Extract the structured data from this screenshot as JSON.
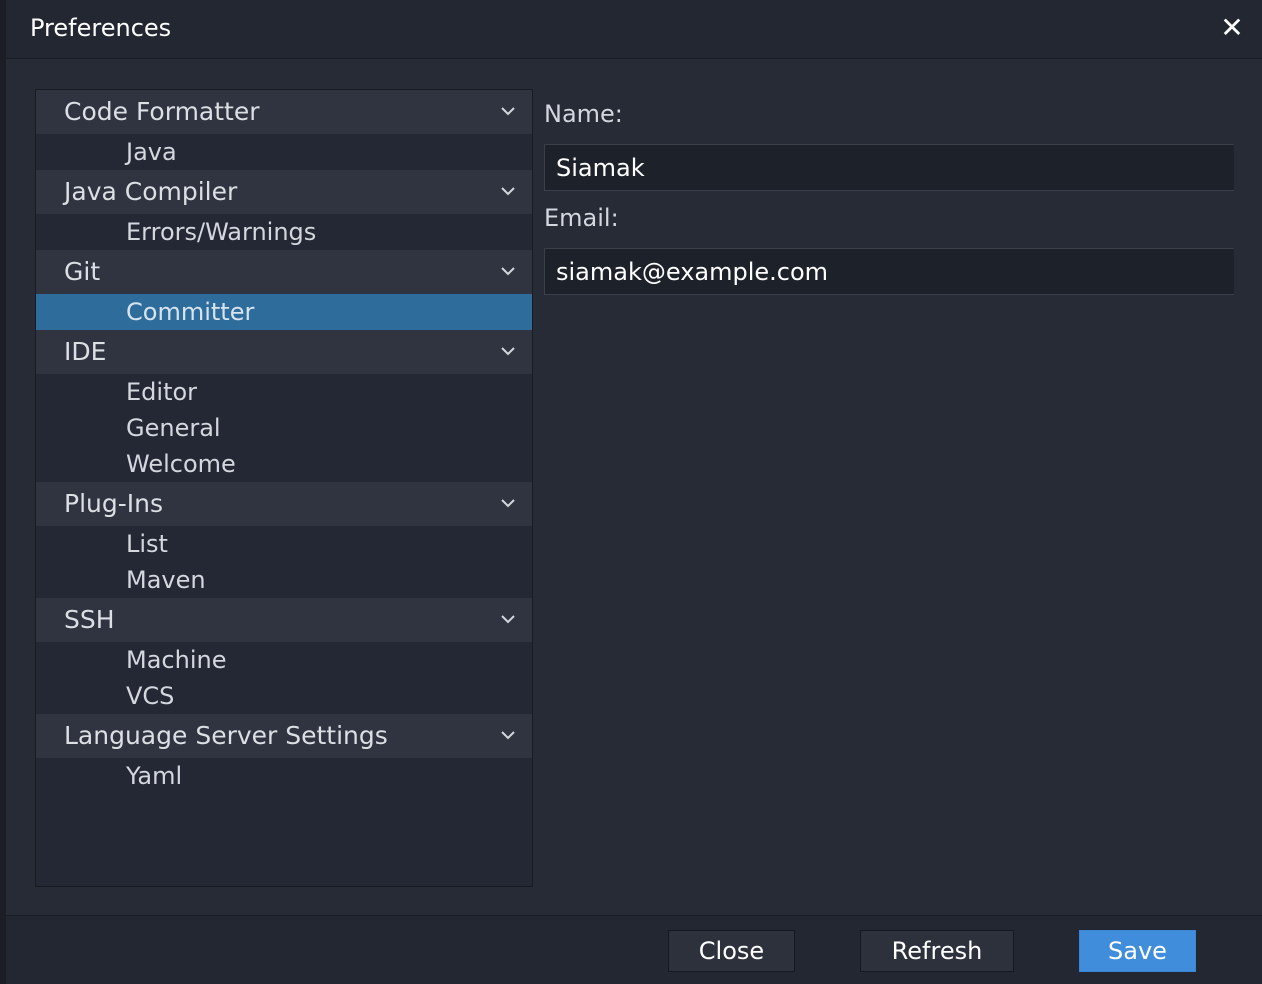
{
  "dialog": {
    "title": "Preferences"
  },
  "tree": {
    "groups": [
      {
        "label": "Code Formatter",
        "items": [
          "Java"
        ]
      },
      {
        "label": "Java Compiler",
        "items": [
          "Errors/Warnings"
        ]
      },
      {
        "label": "Git",
        "items": [
          "Committer"
        ]
      },
      {
        "label": "IDE",
        "items": [
          "Editor",
          "General",
          "Welcome"
        ]
      },
      {
        "label": "Plug-Ins",
        "items": [
          "List",
          "Maven"
        ]
      },
      {
        "label": "SSH",
        "items": [
          "Machine",
          "VCS"
        ]
      },
      {
        "label": "Language Server Settings",
        "items": [
          "Yaml"
        ]
      }
    ],
    "selected": "Committer"
  },
  "form": {
    "name_label": "Name:",
    "name_value": "Siamak",
    "email_label": "Email:",
    "email_value": "siamak@example.com"
  },
  "footer": {
    "close_label": "Close",
    "refresh_label": "Refresh",
    "save_label": "Save"
  },
  "colors": {
    "selection": "#2e6c9c",
    "primary_button": "#3f8ddb"
  }
}
